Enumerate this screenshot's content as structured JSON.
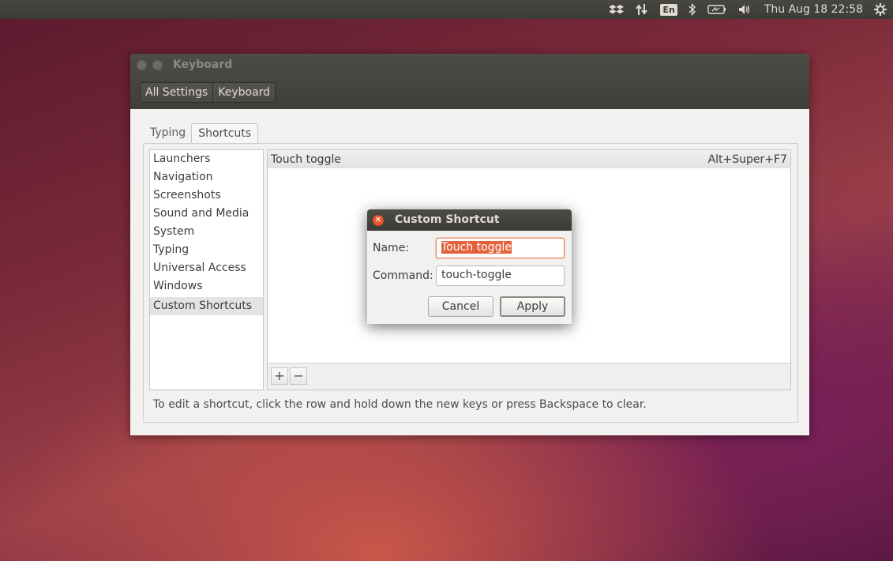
{
  "top_panel": {
    "keyboard_layout": "En",
    "clock": "Thu Aug 18 22:58",
    "icons": [
      "dropbox-icon",
      "network-icon",
      "keyboard-layout-indicator",
      "bluetooth-icon",
      "battery-icon",
      "volume-icon",
      "settings-gear-icon"
    ]
  },
  "window": {
    "title": "Keyboard",
    "breadcrumbs": [
      "All Settings",
      "Keyboard"
    ]
  },
  "tabs": [
    "Typing",
    "Shortcuts"
  ],
  "categories": [
    "Launchers",
    "Navigation",
    "Screenshots",
    "Sound and Media",
    "System",
    "Typing",
    "Universal Access",
    "Windows",
    "Custom Shortcuts"
  ],
  "selected_category": "Custom Shortcuts",
  "shortcut": {
    "name": "Touch toggle",
    "accel": "Alt+Super+F7"
  },
  "toolbar": {
    "add": "+",
    "remove": "−"
  },
  "hint": "To edit a shortcut, click the row and hold down the new keys or press Backspace to clear.",
  "dialog": {
    "title": "Custom Shortcut",
    "name_label": "Name:",
    "name_value": "Touch toggle",
    "command_label": "Command:",
    "command_value": "touch-toggle",
    "cancel": "Cancel",
    "apply": "Apply"
  }
}
